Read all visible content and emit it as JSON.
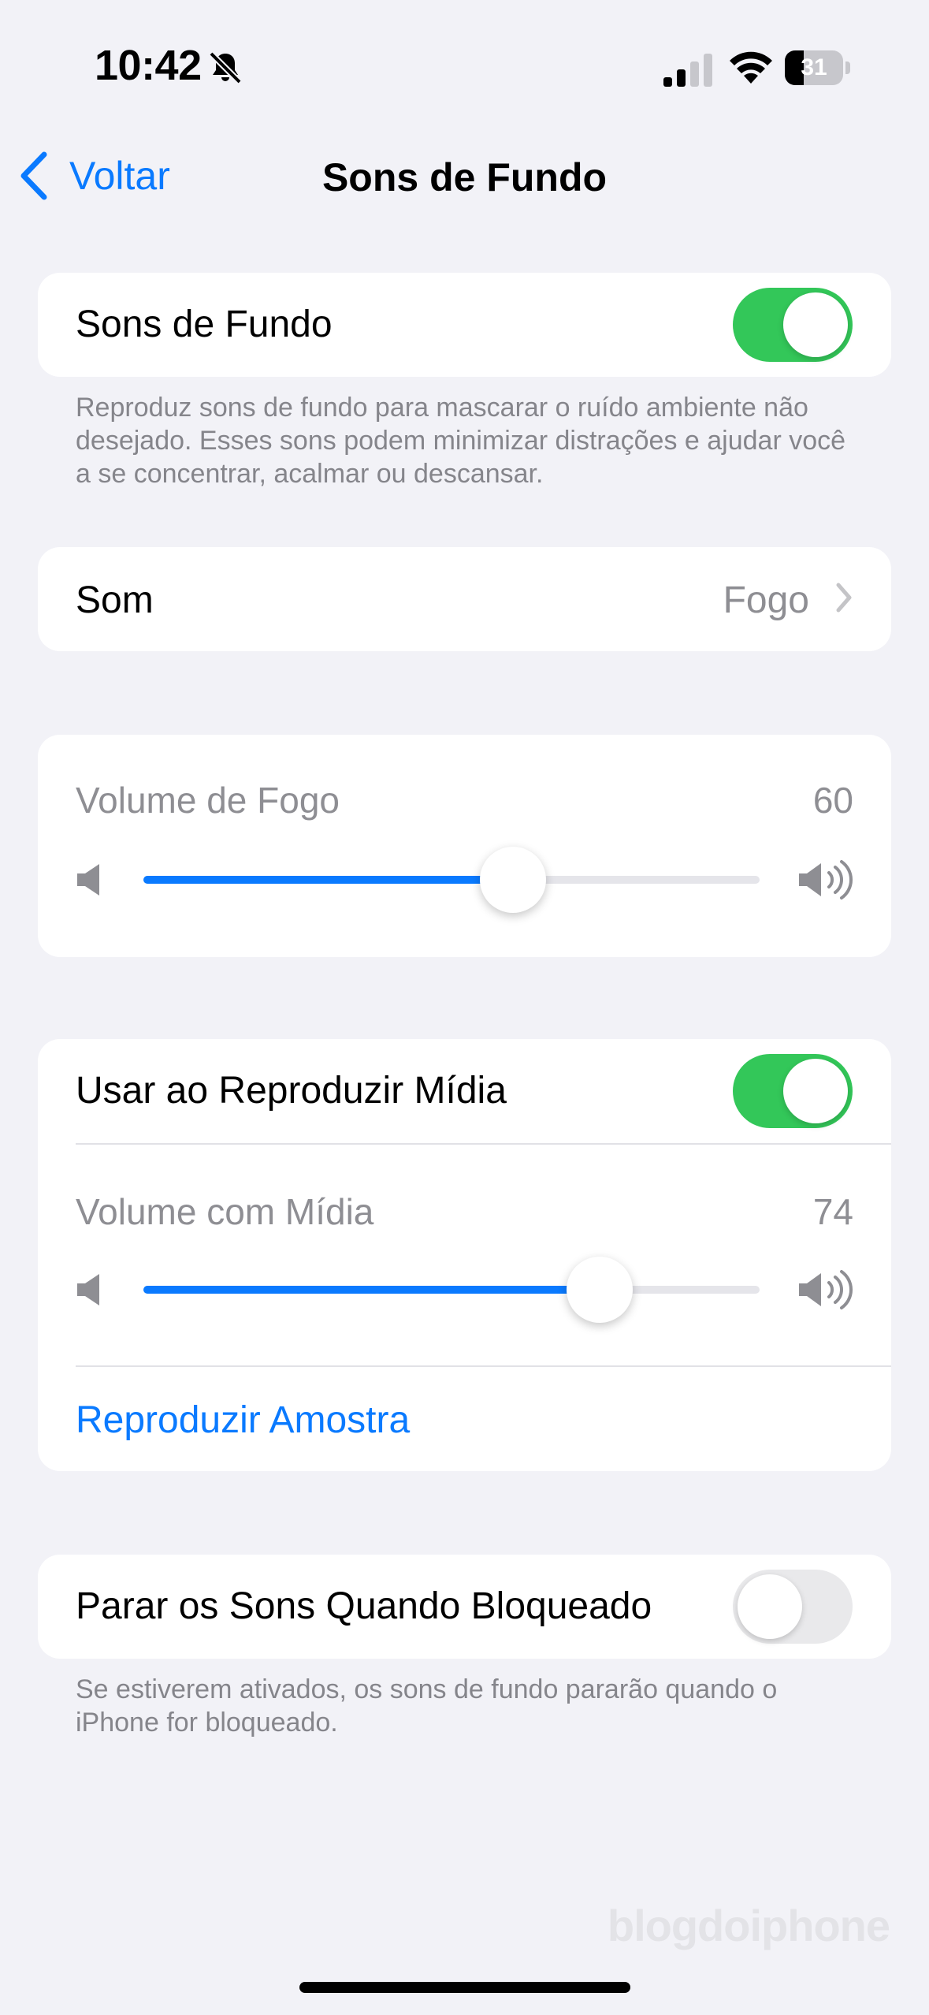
{
  "status_bar": {
    "time": "10:42",
    "battery": "31"
  },
  "nav": {
    "back_label": "Voltar",
    "title": "Sons de Fundo"
  },
  "background_sounds": {
    "label": "Sons de Fundo",
    "enabled": true,
    "footnote": "Reproduz sons de fundo para mascarar o ruído ambiente não desejado. Esses sons podem minimizar distrações e ajudar você a se concentrar, acalmar ou descansar."
  },
  "sound": {
    "label": "Som",
    "value": "Fogo"
  },
  "volume": {
    "label": "Volume de Fogo",
    "value": "60",
    "level": 0.6
  },
  "media": {
    "label": "Usar ao Reproduzir Mídia",
    "enabled": true,
    "volume_label": "Volume com Mídia",
    "volume_value": "74",
    "volume_level": 0.74,
    "play_sample": "Reproduzir Amostra"
  },
  "stop_when_locked": {
    "label": "Parar os Sons Quando Bloqueado",
    "enabled": false,
    "footnote": "Se estiverem ativados, os sons de fundo pararão quando o iPhone for bloqueado."
  },
  "watermark": "blogdoiphone",
  "colors": {
    "accent": "#0a7aff",
    "toggle_on": "#33c759",
    "toggle_off": "#e9e9eb",
    "background": "#f2f2f7"
  }
}
